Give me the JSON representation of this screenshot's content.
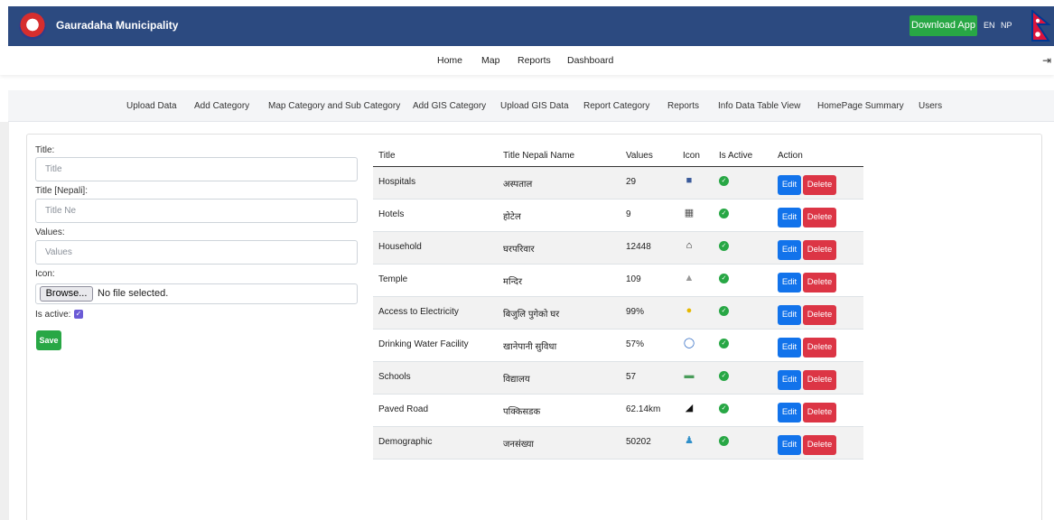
{
  "header": {
    "brand_title": "Gauradaha Municipality",
    "download_label": "Download App",
    "lang_en": "EN",
    "lang_np": "NP",
    "logo_icon": "municipality-emblem-icon",
    "flag_icon": "nepal-flag-icon"
  },
  "main_nav": {
    "home": "Home",
    "map": "Map",
    "reports": "Reports",
    "dashboard": "Dashboard",
    "logout_icon": "logout-icon"
  },
  "admin_nav": [
    "Upload Data",
    "Add Category",
    "Map Category and Sub Category",
    "Add GIS Category",
    "Upload GIS Data",
    "Report Category",
    "Reports",
    "Info Data Table View",
    "HomePage Summary",
    "Users"
  ],
  "form": {
    "title_label": "Title:",
    "title_placeholder": "Title",
    "title_nepali_label": "Title [Nepali]:",
    "title_nepali_placeholder": "Title Ne",
    "values_label": "Values:",
    "values_placeholder": "Values",
    "icon_label": "Icon:",
    "browse_label": "Browse...",
    "file_status": "No file selected.",
    "is_active_label": "Is active:",
    "is_active_checked": true,
    "save_label": "Save"
  },
  "table": {
    "headers": {
      "title": "Title",
      "title_nepali": "Title Nepali Name",
      "values": "Values",
      "icon": "Icon",
      "is_active": "Is Active",
      "action": "Action"
    },
    "edit_label": "Edit",
    "delete_label": "Delete",
    "rows": [
      {
        "title": "Hospitals",
        "nepali": "अस्पताल",
        "value": "29",
        "icon": "hospital-icon",
        "active": true
      },
      {
        "title": "Hotels",
        "nepali": "होटेल",
        "value": "9",
        "icon": "hotel-icon",
        "active": true
      },
      {
        "title": "Household",
        "nepali": "घरपरिवार",
        "value": "12448",
        "icon": "house-icon",
        "active": true
      },
      {
        "title": "Temple",
        "nepali": "मन्दिर",
        "value": "109",
        "icon": "temple-icon",
        "active": true
      },
      {
        "title": "Access to Electricity",
        "nepali": "बिजुलि पुगेको घर",
        "value": "99%",
        "icon": "light-bulb-icon",
        "active": true
      },
      {
        "title": "Drinking Water Facility",
        "nepali": "खानेपानी सुविधा",
        "value": "57%",
        "icon": "water-tap-icon",
        "active": true
      },
      {
        "title": "Schools",
        "nepali": "विद्यालय",
        "value": "57",
        "icon": "school-icon",
        "active": true
      },
      {
        "title": "Paved Road",
        "nepali": "पक्किसडक",
        "value": "62.14km",
        "icon": "road-icon",
        "active": true
      },
      {
        "title": "Demographic",
        "nepali": "जनसंख्या",
        "value": "50202",
        "icon": "people-icon",
        "active": true
      }
    ]
  },
  "colors": {
    "header_bg": "#2c4a80",
    "success": "#28a745",
    "primary": "#1273eb",
    "danger": "#dc3545"
  }
}
